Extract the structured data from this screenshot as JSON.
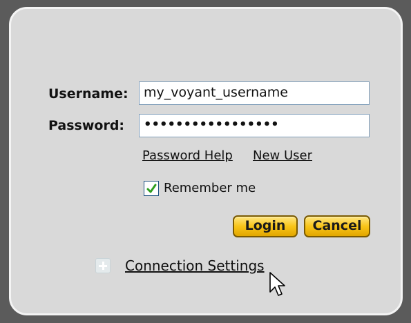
{
  "login": {
    "username_label": "Username:",
    "username_value": "my_voyant_username",
    "password_label": "Password:",
    "password_value": "•••••••••••••••••",
    "password_help": "Password Help",
    "new_user": "New User",
    "remember_me": "Remember me",
    "remember_checked": true,
    "login_button": "Login",
    "cancel_button": "Cancel",
    "connection_settings": "Connection Settings"
  },
  "icons": {
    "remember_check": "checkmark-icon",
    "expand": "plus-icon",
    "cursor": "mouse-pointer-icon"
  },
  "colors": {
    "panel_bg": "#d9d9d9",
    "button_gold": "#f8c418",
    "check_green": "#2e9e1f"
  }
}
